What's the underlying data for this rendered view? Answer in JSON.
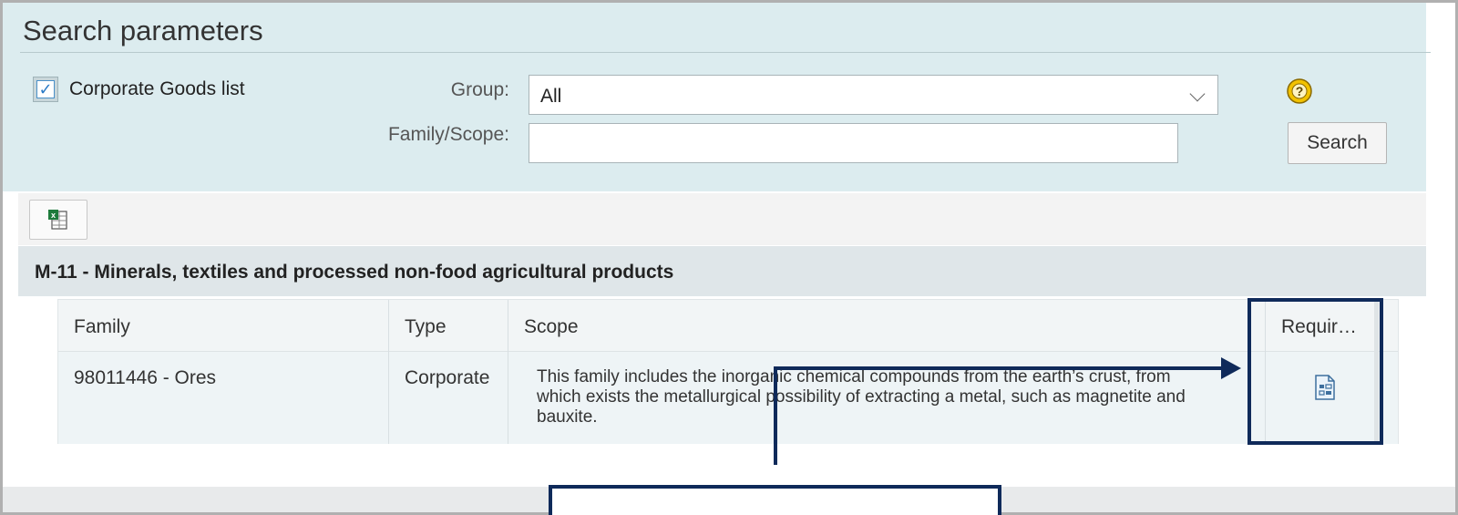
{
  "search": {
    "title": "Search parameters",
    "corporate_checkbox_label": "Corporate Goods list",
    "corporate_checked": true,
    "group_label": "Group:",
    "group_value": "All",
    "family_scope_label": "Family/Scope:",
    "family_scope_value": "",
    "search_button": "Search",
    "help_icon": "help-icon"
  },
  "toolbar": {
    "export_icon": "export-spreadsheet-icon"
  },
  "group": {
    "title": "M-11 - Minerals, textiles and processed non-food agricultural products"
  },
  "table": {
    "columns": [
      "Family",
      "Type",
      "Scope",
      "Requir…"
    ],
    "rows": [
      {
        "family": "98011446 - Ores",
        "type": "Corporate",
        "scope": "This family includes the inorganic chemical compounds from the earth’s crust, from which exists the metallurgical possibility of extracting a metal, such as magnetite and bauxite.",
        "requirements_icon": "requirements-document-icon"
      }
    ]
  },
  "colors": {
    "panel_bg": "#dcecef",
    "annotation": "#0f2a5a",
    "group_header_bg": "#dfe6e9"
  }
}
